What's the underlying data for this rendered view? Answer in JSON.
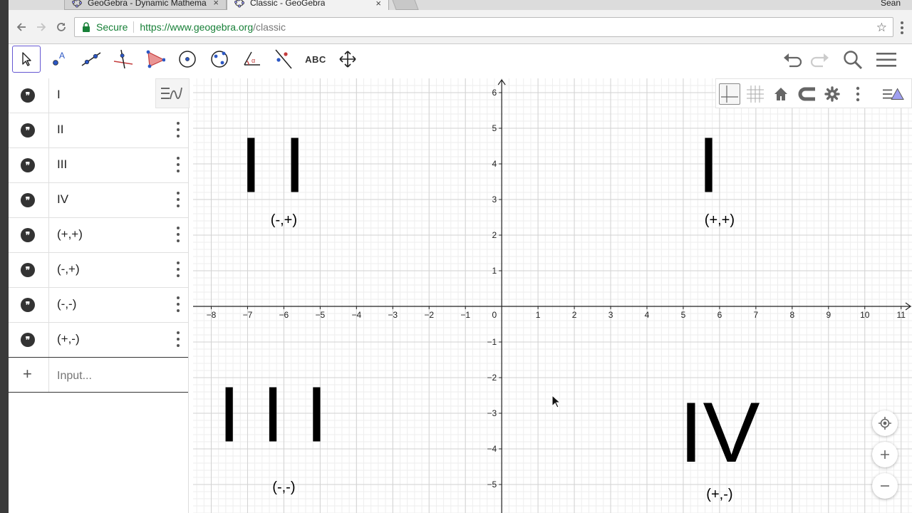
{
  "browser": {
    "tabs": [
      {
        "title": "GeoGebra - Dynamic Mathema",
        "close": "×"
      },
      {
        "title": "Classic - GeoGebra",
        "close": "×"
      }
    ],
    "profile_name": "Sean",
    "secure_label": "Secure",
    "url_host": "https://www.geogebra.org",
    "url_path": "/classic"
  },
  "geogebra_toolbar": {
    "tools": [
      "move-icon",
      "point-icon",
      "line-icon",
      "perpendicular-line-icon",
      "polygon-icon",
      "circle-icon",
      "conic-icon",
      "angle-icon",
      "reflect-icon",
      "text-tool",
      "move-graphics-icon"
    ],
    "text_tool_label": "ABC",
    "right_tools": [
      "undo-icon",
      "redo-icon",
      "search-icon",
      "menu-icon"
    ]
  },
  "algebra_view": {
    "items": [
      {
        "label": "I"
      },
      {
        "label": "II"
      },
      {
        "label": "III"
      },
      {
        "label": "IV"
      },
      {
        "label": "(+,+)"
      },
      {
        "label": "(-,+)"
      },
      {
        "label": "(-,-)"
      },
      {
        "label": "(+,-)"
      }
    ],
    "input_placeholder": "Input..."
  },
  "graphics_view": {
    "x_range": [
      -8.5,
      11.3
    ],
    "y_range": [
      -5.8,
      6.4
    ],
    "x_ticks": [
      -8,
      -7,
      -6,
      -5,
      -4,
      -3,
      -2,
      -1,
      1,
      2,
      3,
      4,
      5,
      6,
      7,
      8,
      9,
      10,
      11
    ],
    "y_ticks": [
      -5,
      -4,
      -3,
      -2,
      -1,
      1,
      2,
      3,
      4,
      5,
      6
    ],
    "origin_label": "0",
    "grid": "major-and-minor",
    "quadrant_labels": [
      {
        "numeral": "II",
        "sign": "(-,+)",
        "x": -6,
        "y": 4
      },
      {
        "numeral": "I",
        "sign": "(+,+)",
        "x": 6,
        "y": 4
      },
      {
        "numeral": "III",
        "sign": "(-,-)",
        "x": -6,
        "y": -3
      },
      {
        "numeral": "IV",
        "sign": "(+,-)",
        "x": 6,
        "y": -3.5
      }
    ],
    "style_bar": [
      "axes-icon",
      "grid-icon",
      "home-icon",
      "magnet-icon",
      "settings-icon",
      "more-icon",
      "toggle-style-bar-icon"
    ],
    "zoom_controls": [
      "locate-icon",
      "zoom-in-icon",
      "zoom-out-icon"
    ]
  }
}
